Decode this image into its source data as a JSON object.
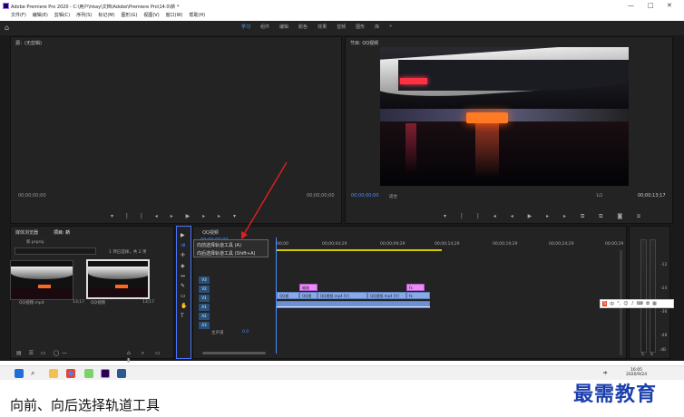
{
  "window": {
    "title": "Adobe Premiere Pro 2020 - C:\\用户\\hkay\\文档\\Adobe\\Premiere Pro\\14.0\\新 *",
    "menu": [
      "文件(F)",
      "编辑(E)",
      "剪辑(C)",
      "序列(S)",
      "标记(M)",
      "图形(G)",
      "视图(V)",
      "窗口(W)",
      "帮助(H)"
    ],
    "min_glyph": "—",
    "max_glyph": "□",
    "close_glyph": "✕"
  },
  "workspace": {
    "home_glyph": "⌂",
    "tabs": [
      "学习",
      "组件",
      "编辑",
      "颜色",
      "效果",
      "音频",
      "图形",
      "库"
    ],
    "active_tab": 0,
    "more_glyph": "»"
  },
  "source": {
    "title": "源：(无剪辑)",
    "timecode_left": "00;00;00;00",
    "timecode_right": "00;00;00;00"
  },
  "program": {
    "title": "节目: QQ视频",
    "timecode_left": "00;00;00;00",
    "fit_label": "适合",
    "ratio": "1/2",
    "timecode_right": "00;00;13;17"
  },
  "project": {
    "tab1": "媒体浏览器",
    "tab2": "项目: 新",
    "project_name": "新.prproj",
    "selection_info": "1 项已选择，共 2 项",
    "items": [
      {
        "name": "QQ视频.mp4",
        "duration": "13;17"
      },
      {
        "name": "QQ视频",
        "duration": "13;17"
      }
    ]
  },
  "timeline": {
    "title": "QQ视频",
    "playhead": "00;00;00;00",
    "ruler": [
      "00;00",
      "00;00;04;29",
      "00;00;09;29",
      "00;00;14;29",
      "00;00;19;29",
      "00;00;24;29",
      "00;00;29"
    ],
    "video_tracks": [
      "V3",
      "V2",
      "V1"
    ],
    "audio_tracks": [
      "A1",
      "A2",
      "A3"
    ],
    "master_label": "主声道",
    "master_value": "0.0",
    "pink_clips": [
      "缩放",
      "fx"
    ],
    "v1_clips": [
      "QQ视",
      "QQ视",
      "QQ视频.mp4 [V]",
      "QQ视频.mp4 [V]",
      "fx"
    ]
  },
  "tooltip": {
    "line1": "向前选择轨道工具 (A)",
    "line2": "向后选择轨道工具 (Shift+A)"
  },
  "meter": {
    "labels": [
      "-12",
      "-24",
      "-36",
      "-48",
      "dB"
    ],
    "ss": [
      "S",
      "S"
    ]
  },
  "ime": {
    "label": "中"
  },
  "taskbar": {
    "time": "16:05",
    "date": "2020/9/24",
    "lang": "中"
  },
  "caption": "向前、向后选择轨道工具",
  "watermark": "最需教育",
  "colors": {
    "accent": "#4a8cff",
    "clip_video": "#8aaae4",
    "clip_effect": "#e98cf5",
    "arrow": "#e02020"
  }
}
